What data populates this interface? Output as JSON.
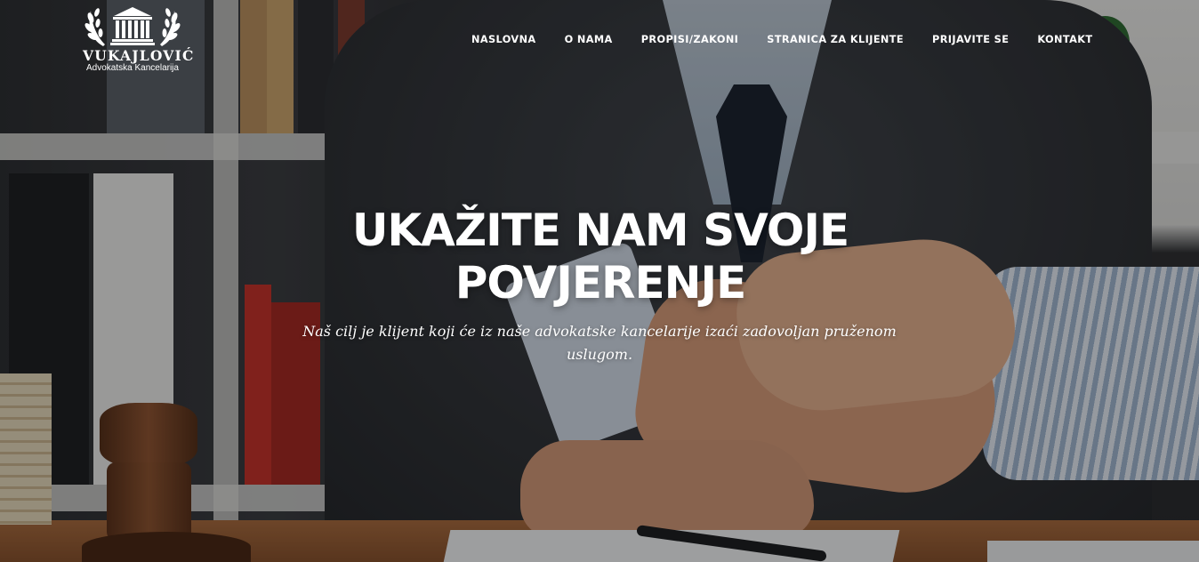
{
  "brand": {
    "name": "VUKAJLOVIĆ",
    "tagline": "Advokatska Kancelarija",
    "logo_icon": "courthouse-laurel-icon"
  },
  "nav": {
    "items": [
      {
        "label": "NASLOVNA"
      },
      {
        "label": "O NAMA"
      },
      {
        "label": "PROPISI/ZAKONI"
      },
      {
        "label": "STRANICA ZA KLIJENTE"
      },
      {
        "label": "PRIJAVITE SE"
      },
      {
        "label": "KONTAKT"
      }
    ]
  },
  "hero": {
    "title_line1": "UKAŽITE NAM SVOJE",
    "title_line2": "POVJERENJE",
    "subtitle": "Naš cilj je klijent koji će iz naše advokatske kancelarije izaći zadovoljan pruženom uslugom.",
    "background": "handshake-office-photo"
  },
  "colors": {
    "text": "#ffffff",
    "overlay": "rgba(0,0,0,0.34)"
  }
}
